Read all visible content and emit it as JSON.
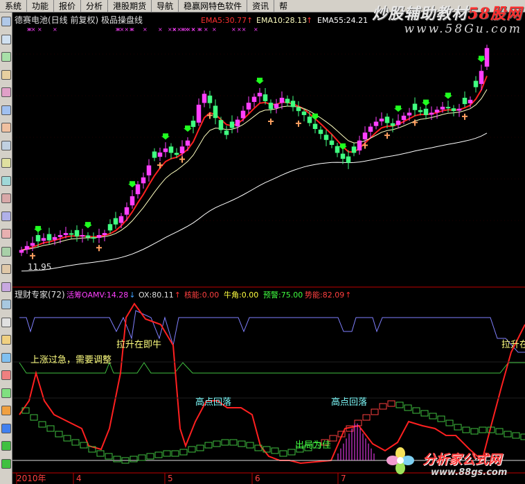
{
  "menu": {
    "items": [
      "系统",
      "功能",
      "报价",
      "分析",
      "港股期货",
      "导航",
      "稳赢网特色软件",
      "资讯"
    ],
    "tail": "帮"
  },
  "watermark_top": {
    "title_a": "炒股辅助",
    "title_b": "教材",
    "title_c": "58股网",
    "url": "www.58Gu.com"
  },
  "watermark_bottom": {
    "title": "分析家公式网",
    "url": "www.88gs.com"
  },
  "main_panel": {
    "title": "德赛电池(日线 前复权) 极品操盘线",
    "ema5_label": "EMA5:30.77",
    "ema10_label": "EMA10:28.13",
    "ema55_label": "EMA55:24.21",
    "low_price_label": "11.95"
  },
  "sub_panel": {
    "title": "理财专家(72)",
    "vals": [
      {
        "text": "活筹OAMV:14.28",
        "arrow": "↓",
        "color": "#ff40ff"
      },
      {
        "text": "OX:80.11",
        "arrow": "↑",
        "color": "#e0e0e0"
      },
      {
        "text": "核能:0.00",
        "arrow": "",
        "color": "#ff4040"
      },
      {
        "text": "牛角:0.00",
        "arrow": "",
        "color": "#ffff40"
      },
      {
        "text": "预警:75.00",
        "arrow": "",
        "color": "#40ff40"
      },
      {
        "text": "势能:82.09",
        "arrow": "↑",
        "color": "#ff4040"
      }
    ],
    "annotations": {
      "pull_up_1": "拉升在即牛",
      "pull_up_2": "拉升在",
      "overheated": "上涨过急，需要调整",
      "high_fall_1": "高点回落",
      "high_fall_2": "高点回落",
      "exit": "出局为佳"
    }
  },
  "x_axis": {
    "labels": [
      "2010年",
      "4",
      "5",
      "6",
      "7"
    ]
  },
  "chart_data": {
    "type": "candlestick",
    "title": "德赛电池(日线 前复权) 极品操盘线",
    "period": "日线",
    "start_label": "2010年",
    "month_labels": [
      "4",
      "5",
      "6",
      "7"
    ],
    "series": [
      {
        "name": "EMA5",
        "last": 30.77,
        "color": "#ff2020"
      },
      {
        "name": "EMA10",
        "last": 28.13,
        "color": "#ffffc0"
      },
      {
        "name": "EMA55",
        "last": 24.21,
        "color": "#ffffff"
      }
    ],
    "price_annotation": {
      "label": "11.95",
      "value": 11.95
    },
    "close_path": [
      12.2,
      12.6,
      12.9,
      13.1,
      13.4,
      13.2,
      13.5,
      13.7,
      13.9,
      13.8,
      13.6,
      13.7,
      13.5,
      13.4,
      13.7,
      13.9,
      14.2,
      14.8,
      15.6,
      16.5,
      17.6,
      18.8,
      19.5,
      20.7,
      21.5,
      22.0,
      22.4,
      22.0,
      21.8,
      22.6,
      23.2,
      24.6,
      26.8,
      27.9,
      27.0,
      25.5,
      24.3,
      23.8,
      24.5,
      25.3,
      26.2,
      27.0,
      27.6,
      28.0,
      27.2,
      26.4,
      26.9,
      27.5,
      27.0,
      26.6,
      26.2,
      25.8,
      25.0,
      24.4,
      23.9,
      23.3,
      22.8,
      22.0,
      21.4,
      21.0,
      22.0,
      23.2,
      24.0,
      24.6,
      25.1,
      25.4,
      25.0,
      24.7,
      25.2,
      25.7,
      26.0,
      26.3,
      26.1,
      25.8,
      26.0,
      26.3,
      26.6,
      26.5,
      26.2,
      26.4,
      26.9,
      27.3,
      28.6,
      30.2,
      32.5
    ],
    "sub_indicator": {
      "name": "理财专家",
      "param": 72,
      "values": {
        "活筹OAMV": 14.28,
        "OX": 80.11,
        "核能": 0.0,
        "牛角": 0.0,
        "预警": 75.0,
        "势能": 82.09
      }
    }
  }
}
